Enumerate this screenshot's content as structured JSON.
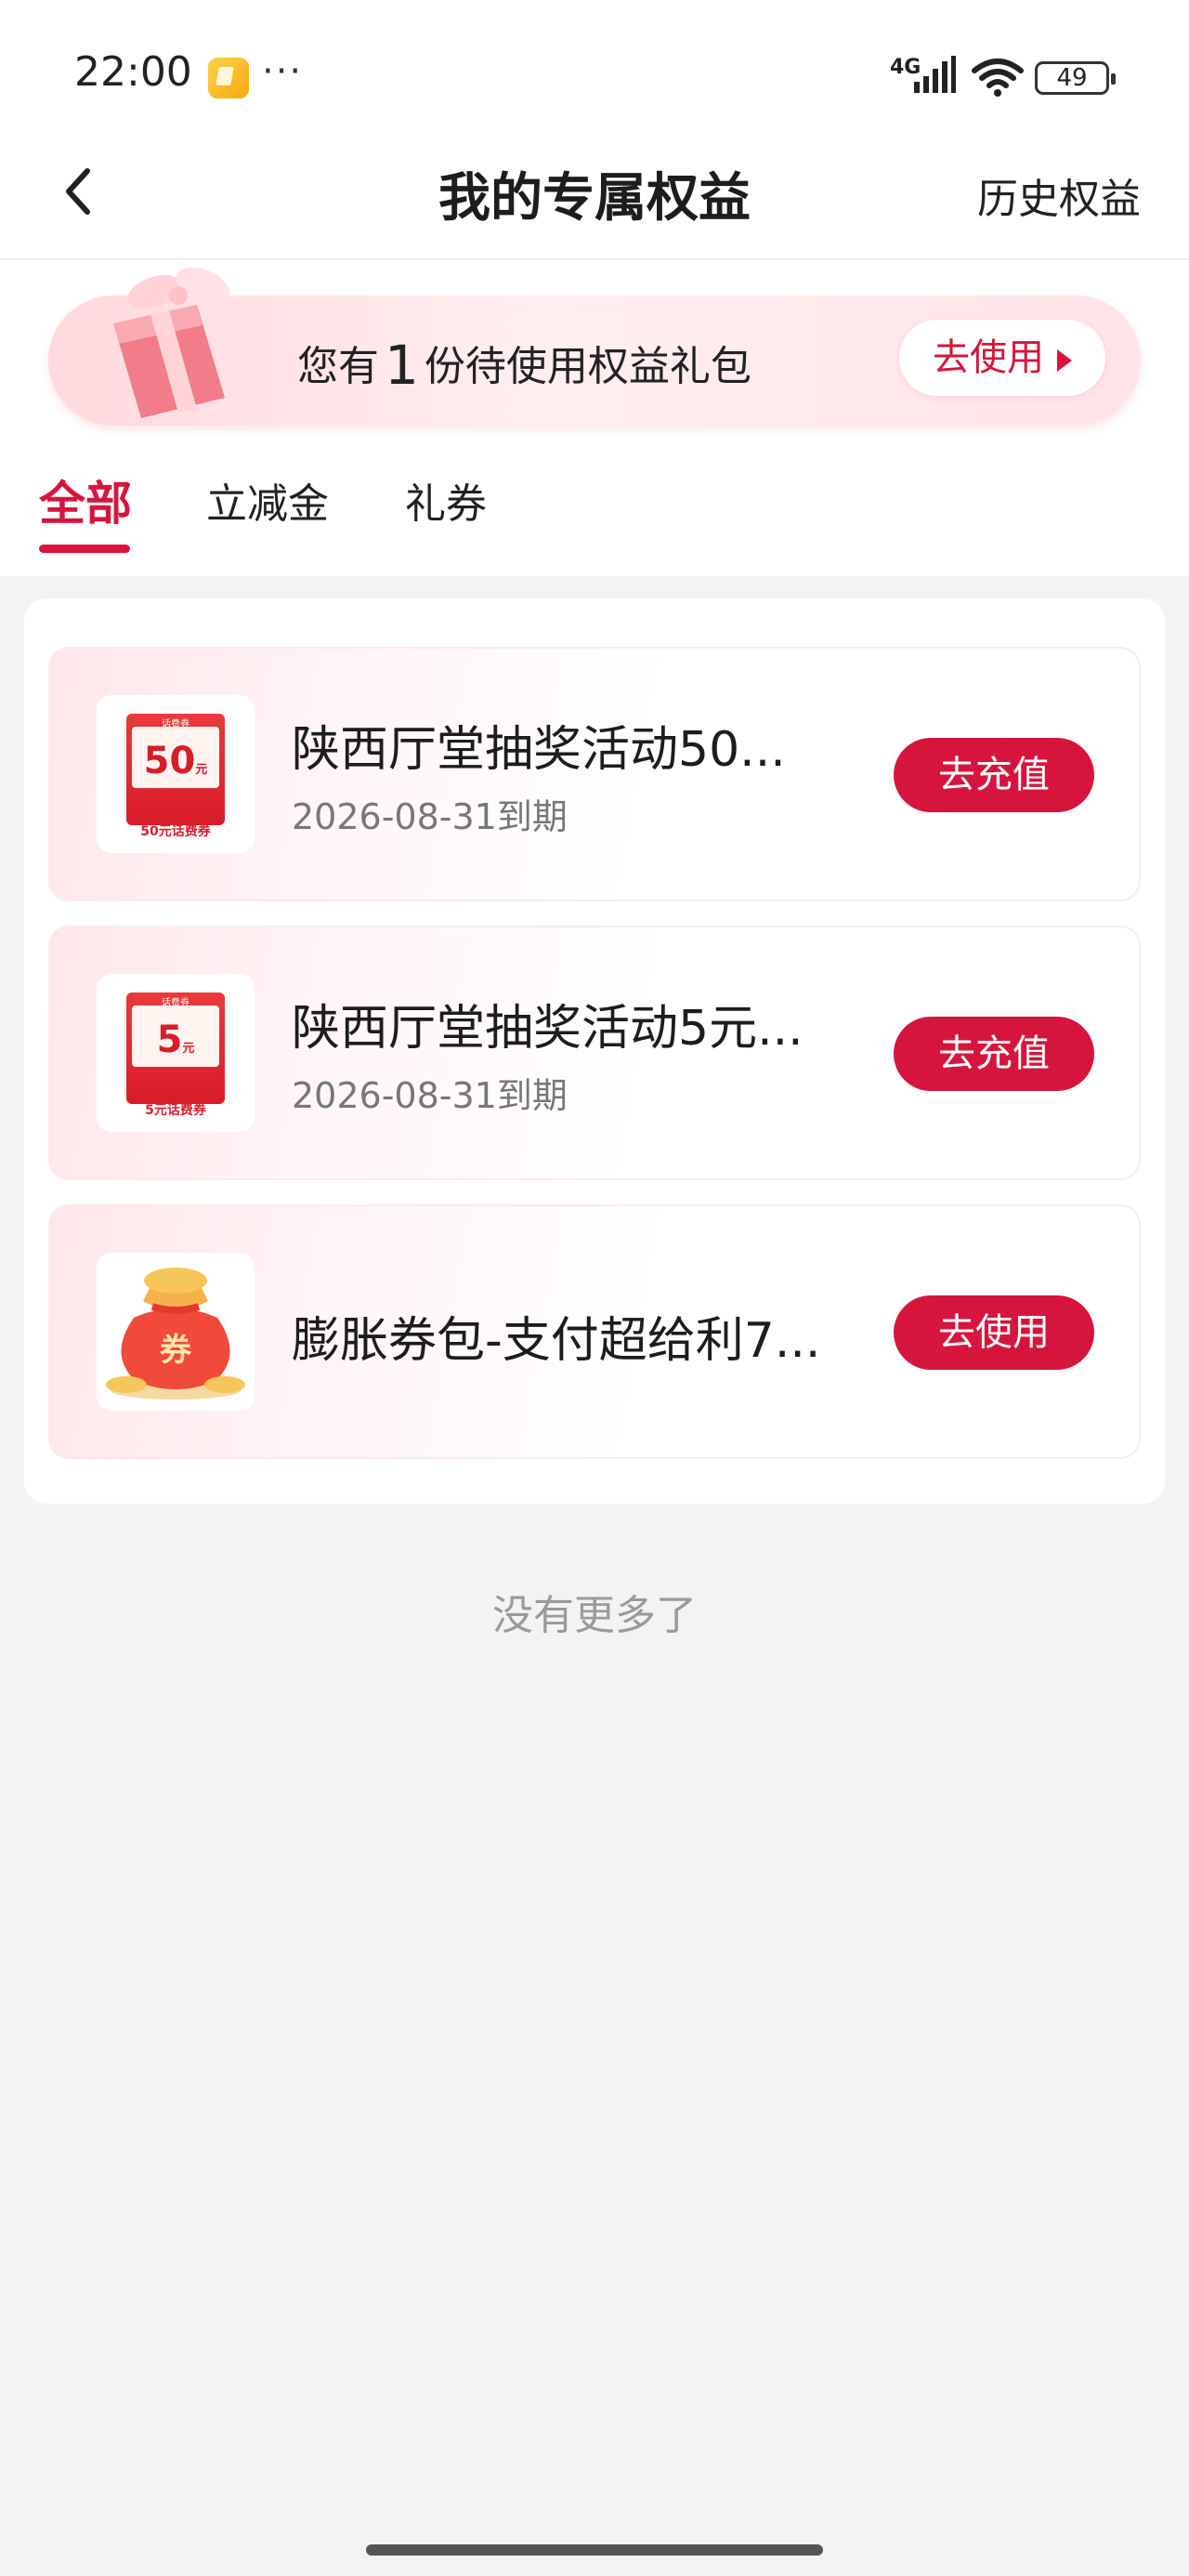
{
  "status_bar": {
    "time": "22:00",
    "more": "···",
    "network": "4G",
    "battery": "49"
  },
  "nav": {
    "title": "我的专属权益",
    "history": "历史权益"
  },
  "banner": {
    "prefix": "您有",
    "count": "1",
    "suffix": "份待使用权益礼包",
    "button": "去使用"
  },
  "tabs": [
    {
      "label": "全部",
      "active": true
    },
    {
      "label": "立减金",
      "active": false
    },
    {
      "label": "礼券",
      "active": false
    }
  ],
  "items": [
    {
      "title": "陕西厅堂抽奖活动50...",
      "expiry": "2026-08-31到期",
      "button": "去充值",
      "thumb": {
        "top": "话费券",
        "value": "50",
        "unit": "元",
        "bottom": "50元话费券"
      }
    },
    {
      "title": "陕西厅堂抽奖活动5元...",
      "expiry": "2026-08-31到期",
      "button": "去充值",
      "thumb": {
        "top": "话费券",
        "value": "5",
        "unit": "元",
        "bottom": "5元话费券"
      }
    },
    {
      "title": "膨胀券包-支付超给利7...",
      "expiry": "",
      "button": "去使用",
      "thumb": {
        "label": "券"
      }
    }
  ],
  "footer": {
    "no_more": "没有更多了"
  },
  "colors": {
    "accent": "#d6153d",
    "background": "#f3f3f3"
  }
}
